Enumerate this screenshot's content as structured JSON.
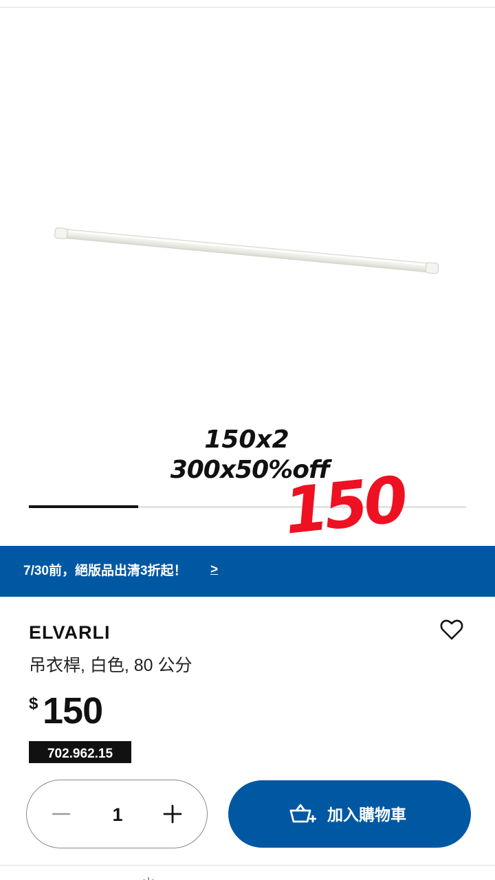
{
  "product_image": {
    "icon": "clothes-rail-product-image"
  },
  "promo_overlay": {
    "line1": "150x2",
    "line2": "300x50%off",
    "sale_price": "150",
    "sale_price_color": "#ee1122"
  },
  "carousel": {
    "progress": 0.25,
    "total_images": 4,
    "current_image": 1
  },
  "promo_banner": {
    "text": "7/30前，絕版品出清3折起！",
    "arrow": ">",
    "background": "#0058a3"
  },
  "product": {
    "name": "ELVARLI",
    "description": "吊衣桿, 白色, 80 公分",
    "currency_symbol": "$",
    "price": "150",
    "article_number": "702.962.15"
  },
  "purchase": {
    "quantity": "1",
    "minus_icon": "minus-icon",
    "plus_icon": "plus-icon",
    "add_to_cart_label": "加入購物車",
    "cart_icon": "shopping-basket-add-icon",
    "accent_color": "#0058a3"
  },
  "wishlist": {
    "icon": "heart-outline-icon"
  }
}
